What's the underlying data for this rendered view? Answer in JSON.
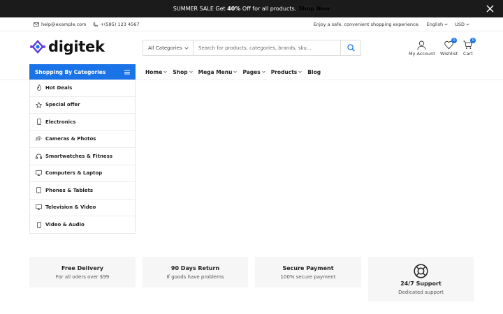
{
  "promo": {
    "text_before": "SUMMER SALE Get ",
    "highlight": "40%",
    "text_after": " Off for all products.",
    "link": "Shop Now"
  },
  "topbar": {
    "email": "help@example.com",
    "phone": "+(585) 123 4567",
    "tagline": "Enjoy a safe, convenient shopping experience.",
    "language": "English",
    "currency": "USD"
  },
  "header": {
    "logo_text": "digitek",
    "search_category": "All Categories",
    "search_placeholder": "Search for products, categories, brands, sku...",
    "account_label": "My Account",
    "wishlist_label": "Wishlist",
    "wishlist_count": "0",
    "cart_label": "Cart",
    "cart_count": "0",
    "accent_color": "#1b73e8"
  },
  "nav": {
    "categories_button": "Shopping By Categories",
    "items": [
      {
        "label": "Home",
        "dropdown": true
      },
      {
        "label": "Shop",
        "dropdown": true
      },
      {
        "label": "Mega Menu",
        "dropdown": true
      },
      {
        "label": "Pages",
        "dropdown": true
      },
      {
        "label": "Products",
        "dropdown": true
      },
      {
        "label": "Blog",
        "dropdown": false
      }
    ]
  },
  "categories": [
    {
      "label": "Hot Deals",
      "icon": "flame-icon"
    },
    {
      "label": "Special offer",
      "icon": "star-icon"
    },
    {
      "label": "Electronics",
      "icon": "phone-icon"
    },
    {
      "label": "Cameras & Photos",
      "icon": "camera-icon"
    },
    {
      "label": "Smartwatches & Fitness",
      "icon": "headphones-icon"
    },
    {
      "label": "Computers & Laptop",
      "icon": "monitor-icon"
    },
    {
      "label": "Phones & Tablets",
      "icon": "tablet-icon"
    },
    {
      "label": "Television & Video",
      "icon": "tv-icon"
    },
    {
      "label": "Video & Audio",
      "icon": "phone-icon"
    }
  ],
  "features": [
    {
      "title": "Free Delivery",
      "subtitle": "For all oders over $99"
    },
    {
      "title": "90 Days Return",
      "subtitle": "If goods have problems"
    },
    {
      "title": "Secure Payment",
      "subtitle": "100% secure payment"
    },
    {
      "title": "24/7 Support",
      "subtitle": "Dedicated support",
      "icon": "lifebuoy-icon"
    }
  ]
}
